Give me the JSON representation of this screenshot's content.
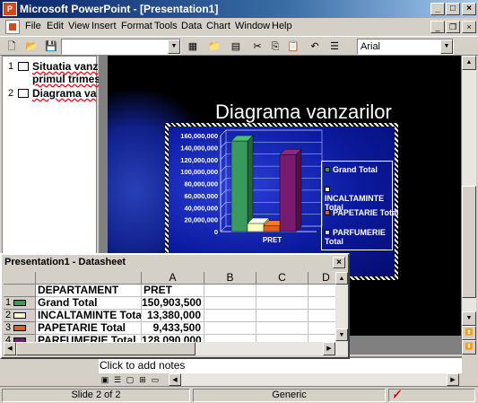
{
  "window": {
    "title": "Microsoft PowerPoint - [Presentation1]"
  },
  "menu": [
    "File",
    "Edit",
    "View",
    "Insert",
    "Format",
    "Tools",
    "Data",
    "Chart",
    "Window",
    "Help"
  ],
  "toolbar": {
    "font": "Arial"
  },
  "outline": [
    {
      "num": "1",
      "lines": [
        "Situatia vanz",
        "primul trimes"
      ]
    },
    {
      "num": "2",
      "lines": [
        "Diagrama va"
      ]
    }
  ],
  "slide": {
    "title": "Diagrama vanzarilor"
  },
  "chart_data": {
    "type": "bar",
    "categories": [
      "PRET"
    ],
    "series": [
      {
        "name": "Grand Total",
        "values": [
          150903500
        ],
        "color": "#3a9a5c"
      },
      {
        "name": "INCALTAMINTE Total",
        "values": [
          13380000
        ],
        "color": "#ffffc0"
      },
      {
        "name": "PAPETARIE Total",
        "values": [
          9433500
        ],
        "color": "#e06020"
      },
      {
        "name": "PARFUMERIE Total",
        "values": [
          128090000
        ],
        "color": "#7a1a6e"
      }
    ],
    "ylim": [
      0,
      160000000
    ],
    "yticks": [
      "160,000,000",
      "140,000,000",
      "120,000,000",
      "100,000,000",
      "80,000,000",
      "60,000,000",
      "40,000,000",
      "20,000,000",
      "0"
    ],
    "xlabel_visible": "PRET"
  },
  "datasheet": {
    "title": "Presentation1 - Datasheet",
    "columns": [
      "A",
      "B",
      "C",
      "D"
    ],
    "header_row": {
      "a": "DEPARTAMENT",
      "b": "PRET"
    },
    "rows": [
      {
        "num": "1",
        "name": "Grand Total",
        "value": "150,903,500"
      },
      {
        "num": "2",
        "name": "INCALTAMINTE Total",
        "value": "13,380,000"
      },
      {
        "num": "3",
        "name": "PAPETARIE Total",
        "value": "9,433,500"
      },
      {
        "num": "4",
        "name": "PARFUMERIE Total",
        "value": "128,090,000"
      }
    ]
  },
  "notes": {
    "placeholder": "Click to add notes"
  },
  "status": {
    "slide": "Slide 2 of 2",
    "design": "Generic"
  }
}
